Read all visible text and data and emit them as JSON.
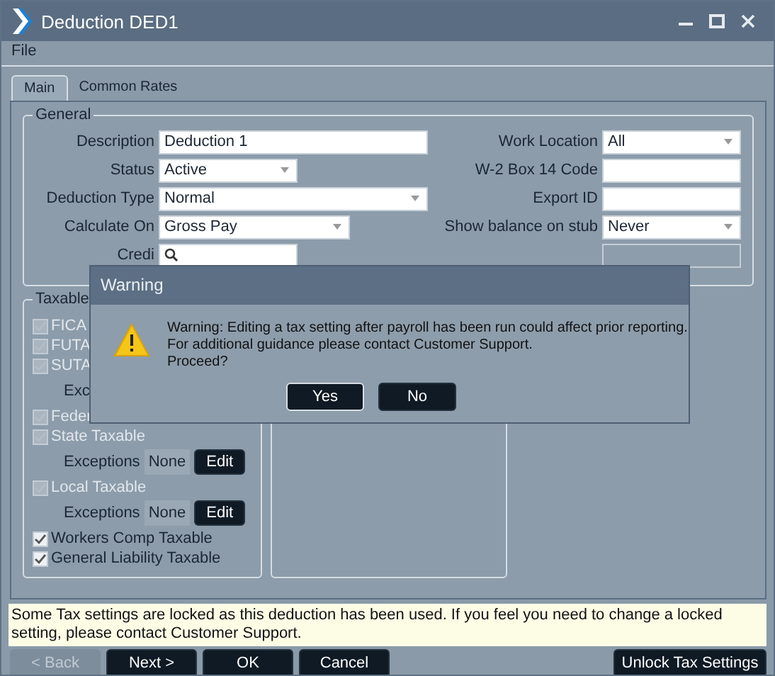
{
  "window": {
    "title": "Deduction DED1"
  },
  "menu": [
    {
      "label": "File"
    }
  ],
  "tabs": [
    {
      "label": "Main",
      "selected": true
    },
    {
      "label": "Common Rates",
      "selected": false
    }
  ],
  "general": {
    "title": "General",
    "left": [
      {
        "label": "Description",
        "kind": "text",
        "value": "Deduction 1"
      },
      {
        "label": "Status",
        "kind": "dropdown",
        "value": "Active"
      },
      {
        "label": "Deduction Type",
        "kind": "dropdown",
        "value": "Normal"
      },
      {
        "label": "Calculate On",
        "kind": "dropdown",
        "value": "Gross Pay"
      },
      {
        "label": "Credi",
        "kind": "lookup"
      }
    ],
    "right": [
      {
        "label": "Work Location",
        "kind": "dropdown",
        "value": "All",
        "disabled": false
      },
      {
        "label": "W-2 Box 14 Code",
        "kind": "text",
        "disabled": false
      },
      {
        "label": "Export ID",
        "kind": "text",
        "disabled": false
      },
      {
        "label": "Show balance on stub",
        "kind": "dropdown",
        "value": "Never",
        "disabled": false
      },
      {
        "kind": "text",
        "disabled": true
      }
    ]
  },
  "taxable": {
    "title": "Taxable",
    "items": [
      {
        "kind": "checkbox",
        "label": "FICA",
        "checked": true,
        "disabled": true
      },
      {
        "kind": "checkbox",
        "label": "FUTA",
        "checked": true,
        "disabled": true
      },
      {
        "kind": "checkbox",
        "label": "SUTA",
        "checked": true,
        "disabled": true
      },
      {
        "kind": "exceptions",
        "label": "Exc"
      },
      {
        "kind": "checkbox",
        "label": "Feder",
        "checked": true,
        "disabled": true
      },
      {
        "kind": "checkbox",
        "label": "State Taxable",
        "checked": true,
        "disabled": true
      },
      {
        "kind": "exceptions",
        "label": "Exceptions",
        "value": "None",
        "button": "Edit"
      },
      {
        "kind": "checkbox",
        "label": "Local Taxable",
        "checked": true,
        "disabled": true
      },
      {
        "kind": "exceptions",
        "label": "Exceptions",
        "value": "None",
        "button": "Edit"
      },
      {
        "kind": "checkbox",
        "label": "Workers Comp Taxable",
        "checked": true,
        "disabled": false
      },
      {
        "kind": "checkbox",
        "label": "General Liability Taxable",
        "checked": true,
        "disabled": false
      }
    ]
  },
  "notice": "Some Tax settings are locked as this deduction has been used. If you feel you need to change a locked setting, please contact Customer Support.",
  "buttons": [
    {
      "label": "< Back",
      "disabled": true
    },
    {
      "label": "Next >",
      "disabled": false
    },
    {
      "label": "OK",
      "disabled": false
    },
    {
      "label": "Cancel",
      "disabled": false
    },
    {
      "label": "Unlock Tax Settings",
      "disabled": false
    }
  ],
  "dialog": {
    "title": "Warning",
    "message": [
      "Warning: Editing a tax setting after payroll has been run could affect prior reporting.",
      "For additional guidance please contact Customer Support.",
      "Proceed?"
    ],
    "buttons": [
      {
        "label": "Yes"
      },
      {
        "label": "No"
      }
    ]
  }
}
